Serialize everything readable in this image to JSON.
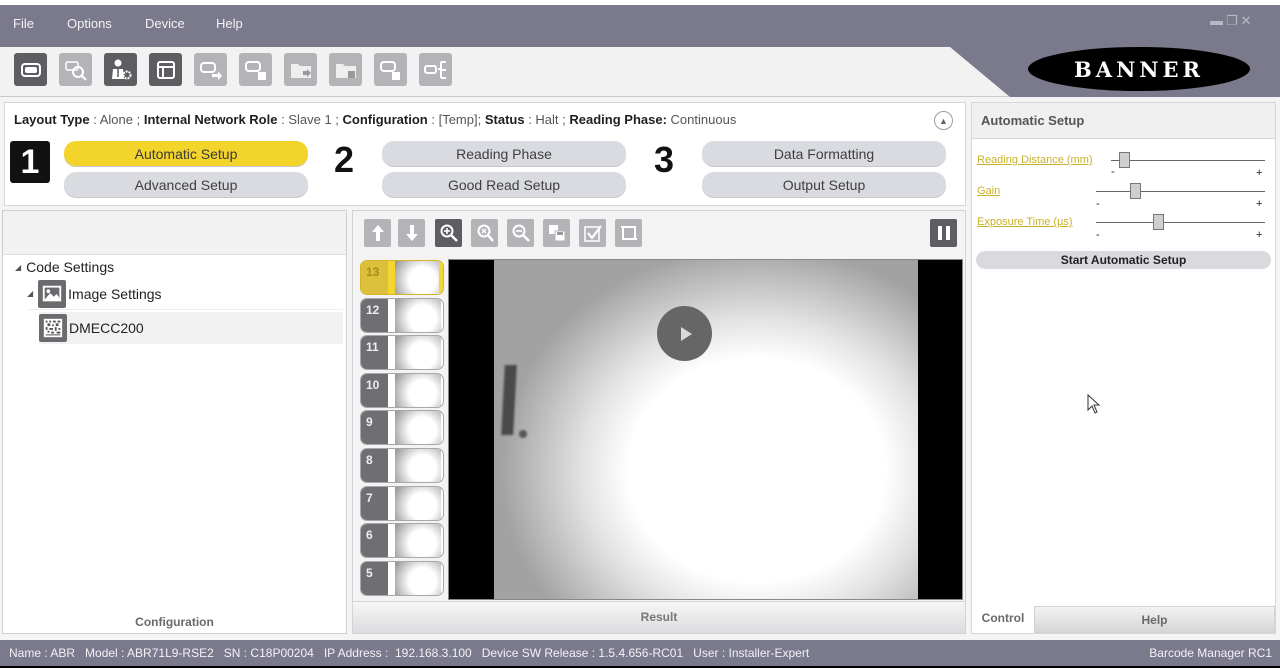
{
  "menu": {
    "items": [
      "File",
      "Options",
      "Device",
      "Help"
    ],
    "window_controls": {
      "minimize": "minimize-icon",
      "restore": "restore-icon",
      "close": "close-icon"
    }
  },
  "toolbar": {
    "buttons": [
      {
        "name": "device-icon",
        "style": "dark"
      },
      {
        "name": "device-search-icon",
        "style": "light"
      },
      {
        "name": "user-settings-icon",
        "style": "dark"
      },
      {
        "name": "layout-icon",
        "style": "dark"
      },
      {
        "name": "device-send-icon",
        "style": "light"
      },
      {
        "name": "device-save-icon",
        "style": "light"
      },
      {
        "name": "folder-send-icon",
        "style": "light"
      },
      {
        "name": "folder-save-icon",
        "style": "light"
      },
      {
        "name": "device-save-alt-icon",
        "style": "light"
      },
      {
        "name": "network-tree-icon",
        "style": "light"
      }
    ],
    "brand": "BANNER"
  },
  "status_info": {
    "layout_type_label": "Layout Type",
    "layout_type_value": "Alone",
    "network_role_label": "Internal Network Role",
    "network_role_value": "Slave 1",
    "configuration_label": "Configuration",
    "configuration_value": "[Temp]",
    "status_label": "Status",
    "status_value": "Halt",
    "reading_phase_label": "Reading Phase:",
    "reading_phase_value": "Continuous"
  },
  "steps": [
    {
      "number": "1",
      "buttons": [
        {
          "label": "Automatic Setup",
          "active": true
        },
        {
          "label": "Advanced Setup",
          "active": false
        }
      ]
    },
    {
      "number": "2",
      "buttons": [
        {
          "label": "Reading Phase",
          "active": false
        },
        {
          "label": "Good Read Setup",
          "active": false
        }
      ]
    },
    {
      "number": "3",
      "buttons": [
        {
          "label": "Data Formatting",
          "active": false
        },
        {
          "label": "Output Setup",
          "active": false
        }
      ]
    }
  ],
  "config_tree": {
    "items": [
      {
        "label": "Code Settings",
        "level": 0,
        "icon": null
      },
      {
        "label": "Image Settings",
        "level": 1,
        "icon": "image-icon"
      },
      {
        "label": "DMECC200",
        "level": 2,
        "icon": "datamatrix-icon"
      }
    ],
    "footer": "Configuration"
  },
  "image_toolbar": {
    "buttons": [
      {
        "name": "arrow-up-icon",
        "style": "light"
      },
      {
        "name": "arrow-down-icon",
        "style": "light"
      },
      {
        "name": "zoom-in-icon",
        "style": "dark"
      },
      {
        "name": "zoom-reset-icon",
        "style": "light"
      },
      {
        "name": "zoom-out-icon",
        "style": "light"
      },
      {
        "name": "save-images-icon",
        "style": "light"
      },
      {
        "name": "checkmark-icon",
        "style": "light"
      },
      {
        "name": "crop-icon",
        "style": "light"
      }
    ],
    "pause": "pause-icon"
  },
  "thumbnails": [
    "13",
    "12",
    "11",
    "10",
    "9",
    "8",
    "7",
    "6",
    "5"
  ],
  "active_thumbnail": "13",
  "result_label": "Result",
  "automatic_setup": {
    "title": "Automatic Setup",
    "params": [
      {
        "label": "Reading Distance (mm)",
        "min": "-",
        "max": "+",
        "value_fraction": 0.05
      },
      {
        "label": "Gain",
        "min": "-",
        "max": "+",
        "value_fraction": 0.2
      },
      {
        "label": "Exposure Time (µs)",
        "min": "-",
        "max": "+",
        "value_fraction": 0.34
      }
    ],
    "start_button": "Start Automatic Setup",
    "tabs": [
      "Control",
      "Help"
    ],
    "active_tab": "Control"
  },
  "statusbar": {
    "left": "Name : ABR   Model : ABR71L9-RSE2   SN : C18P00204   IP Address :  192.168.3.100   Device SW Release : 1.5.4.656-RC01   User : Installer-Expert",
    "right": "Barcode Manager RC1"
  },
  "colors": {
    "accent_yellow": "#f3d42b",
    "chrome": "#7b7a8c",
    "link_yellow": "#c9b02a"
  }
}
